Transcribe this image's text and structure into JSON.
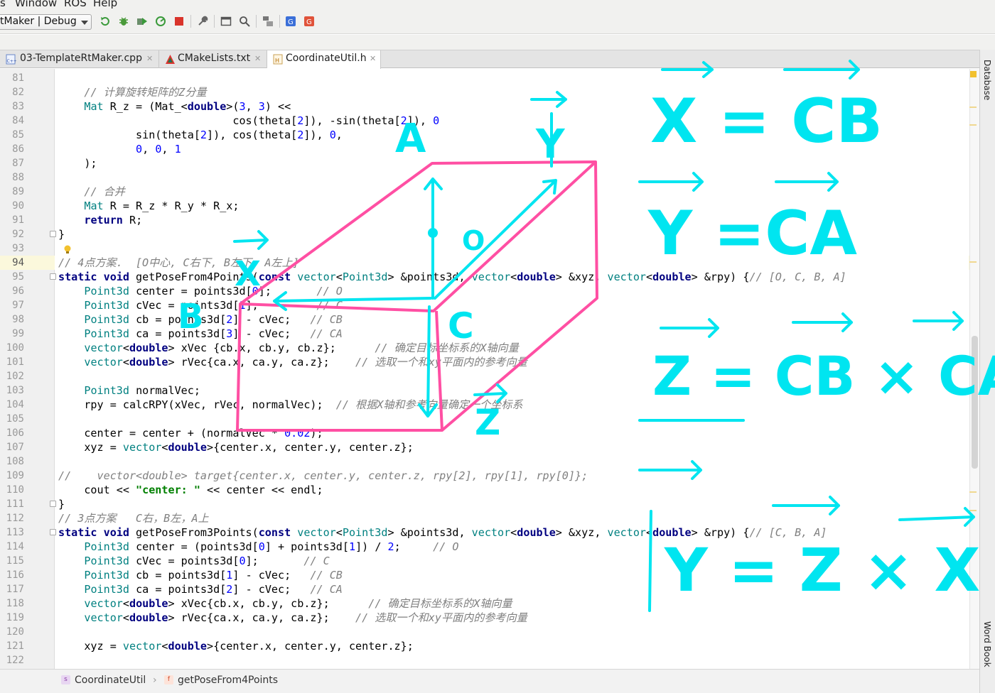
{
  "menu": {
    "item_s": "s",
    "item_window": "Window",
    "item_ros": "ROS",
    "item_help": "Help"
  },
  "toolbar": {
    "run_config": "tMaker | Debug"
  },
  "tabs": [
    {
      "label": "03-TemplateRtMaker.cpp",
      "icon": "cpp-file-icon"
    },
    {
      "label": "CMakeLists.txt",
      "icon": "cmake-icon"
    },
    {
      "label": "CoordinateUtil.h",
      "icon": "header-file-icon"
    }
  ],
  "sidebar": {
    "database": "Database",
    "wordbook": "Word Book"
  },
  "editor": {
    "current_line": "94",
    "lines": [
      {
        "n": "81"
      },
      {
        "n": "82"
      },
      {
        "n": "83"
      },
      {
        "n": "84"
      },
      {
        "n": "85"
      },
      {
        "n": "86"
      },
      {
        "n": "87"
      },
      {
        "n": "88"
      },
      {
        "n": "89"
      },
      {
        "n": "90"
      },
      {
        "n": "91"
      },
      {
        "n": "92"
      },
      {
        "n": "93"
      },
      {
        "n": "94"
      },
      {
        "n": "95"
      },
      {
        "n": "96"
      },
      {
        "n": "97"
      },
      {
        "n": "98"
      },
      {
        "n": "99"
      },
      {
        "n": "100"
      },
      {
        "n": "101"
      },
      {
        "n": "102"
      },
      {
        "n": "103"
      },
      {
        "n": "104"
      },
      {
        "n": "105"
      },
      {
        "n": "106"
      },
      {
        "n": "107"
      },
      {
        "n": "108"
      },
      {
        "n": "109"
      },
      {
        "n": "110"
      },
      {
        "n": "111"
      },
      {
        "n": "112"
      },
      {
        "n": "113"
      },
      {
        "n": "114"
      },
      {
        "n": "115"
      },
      {
        "n": "116"
      },
      {
        "n": "117"
      },
      {
        "n": "118"
      },
      {
        "n": "119"
      },
      {
        "n": "120"
      },
      {
        "n": "121"
      },
      {
        "n": "122"
      }
    ],
    "code": [
      [],
      [
        {
          "t": "    "
        },
        {
          "t": "// 计算旋转矩阵的Z分量",
          "c": "cm"
        }
      ],
      [
        {
          "t": "    "
        },
        {
          "t": "Mat",
          "c": "ty"
        },
        {
          "t": " R_z = (Mat_<"
        },
        {
          "t": "double",
          "c": "kw"
        },
        {
          "t": ">("
        },
        {
          "t": "3",
          "c": "nm"
        },
        {
          "t": ", "
        },
        {
          "t": "3",
          "c": "nm"
        },
        {
          "t": ") <<"
        }
      ],
      [
        {
          "t": "                           cos(theta["
        },
        {
          "t": "2",
          "c": "nm"
        },
        {
          "t": "]), -sin(theta["
        },
        {
          "t": "2",
          "c": "nm"
        },
        {
          "t": "]), "
        },
        {
          "t": "0",
          "c": "nm"
        }
      ],
      [
        {
          "t": "            sin(theta["
        },
        {
          "t": "2",
          "c": "nm"
        },
        {
          "t": "]), cos(theta["
        },
        {
          "t": "2",
          "c": "nm"
        },
        {
          "t": "]), "
        },
        {
          "t": "0",
          "c": "nm"
        },
        {
          "t": ","
        }
      ],
      [
        {
          "t": "            "
        },
        {
          "t": "0",
          "c": "nm"
        },
        {
          "t": ", "
        },
        {
          "t": "0",
          "c": "nm"
        },
        {
          "t": ", "
        },
        {
          "t": "1",
          "c": "nm"
        }
      ],
      [
        {
          "t": "    );"
        }
      ],
      [],
      [
        {
          "t": "    "
        },
        {
          "t": "// 合并",
          "c": "cm"
        }
      ],
      [
        {
          "t": "    "
        },
        {
          "t": "Mat",
          "c": "ty"
        },
        {
          "t": " R = R_z * R_y * R_x;"
        }
      ],
      [
        {
          "t": "    "
        },
        {
          "t": "return",
          "c": "kw"
        },
        {
          "t": " R;"
        }
      ],
      [
        {
          "t": "}"
        }
      ],
      [],
      [
        {
          "t": "// 4点方案.  [O中心, C右下, B左下, A左上]",
          "c": "cm"
        }
      ],
      [
        {
          "t": "static void",
          "c": "kw"
        },
        {
          "t": " getPoseFrom4Points("
        },
        {
          "t": "const",
          "c": "kw"
        },
        {
          "t": " "
        },
        {
          "t": "vector",
          "c": "ty"
        },
        {
          "t": "<"
        },
        {
          "t": "Point3d",
          "c": "ty"
        },
        {
          "t": "> &points3d, "
        },
        {
          "t": "vector",
          "c": "ty"
        },
        {
          "t": "<"
        },
        {
          "t": "double",
          "c": "kw"
        },
        {
          "t": "> &xyz, "
        },
        {
          "t": "vector",
          "c": "ty"
        },
        {
          "t": "<"
        },
        {
          "t": "double",
          "c": "kw"
        },
        {
          "t": "> &rpy) {"
        },
        {
          "t": "// [O, C, B, A]",
          "c": "cm"
        }
      ],
      [
        {
          "t": "    "
        },
        {
          "t": "Point3d",
          "c": "ty"
        },
        {
          "t": " center = points3d["
        },
        {
          "t": "0",
          "c": "nm"
        },
        {
          "t": "];       "
        },
        {
          "t": "// O",
          "c": "cm"
        }
      ],
      [
        {
          "t": "    "
        },
        {
          "t": "Point3d",
          "c": "ty"
        },
        {
          "t": " cVec = points3d["
        },
        {
          "t": "1",
          "c": "nm"
        },
        {
          "t": "];         "
        },
        {
          "t": "// C",
          "c": "cm"
        }
      ],
      [
        {
          "t": "    "
        },
        {
          "t": "Point3d",
          "c": "ty"
        },
        {
          "t": " cb = points3d["
        },
        {
          "t": "2",
          "c": "nm"
        },
        {
          "t": "] - cVec;   "
        },
        {
          "t": "// CB",
          "c": "cm"
        }
      ],
      [
        {
          "t": "    "
        },
        {
          "t": "Point3d",
          "c": "ty"
        },
        {
          "t": " ca = points3d["
        },
        {
          "t": "3",
          "c": "nm"
        },
        {
          "t": "] - cVec;   "
        },
        {
          "t": "// CA",
          "c": "cm"
        }
      ],
      [
        {
          "t": "    "
        },
        {
          "t": "vector",
          "c": "ty"
        },
        {
          "t": "<"
        },
        {
          "t": "double",
          "c": "kw"
        },
        {
          "t": "> xVec {cb.x, cb.y, cb.z};      "
        },
        {
          "t": "// 确定目标坐标系的X轴向量",
          "c": "cm"
        }
      ],
      [
        {
          "t": "    "
        },
        {
          "t": "vector",
          "c": "ty"
        },
        {
          "t": "<"
        },
        {
          "t": "double",
          "c": "kw"
        },
        {
          "t": "> rVec{ca.x, ca.y, ca.z};    "
        },
        {
          "t": "// 选取一个和xy平面内的参考向量",
          "c": "cm"
        }
      ],
      [],
      [
        {
          "t": "    "
        },
        {
          "t": "Point3d",
          "c": "ty"
        },
        {
          "t": " normalVec;"
        }
      ],
      [
        {
          "t": "    rpy = calcRPY(xVec, rVec, normalVec);  "
        },
        {
          "t": "// 根据X轴和参考向量确定一个坐标系",
          "c": "cm"
        }
      ],
      [],
      [
        {
          "t": "    center = center + (normalVec * "
        },
        {
          "t": "0.02",
          "c": "nm"
        },
        {
          "t": ");"
        }
      ],
      [
        {
          "t": "    xyz = "
        },
        {
          "t": "vector",
          "c": "ty"
        },
        {
          "t": "<"
        },
        {
          "t": "double",
          "c": "kw"
        },
        {
          "t": ">{center.x, center.y, center.z};"
        }
      ],
      [],
      [
        {
          "t": "//    vector<double> target{center.x, center.y, center.z, rpy[2], rpy[1], rpy[0]};",
          "c": "cm"
        }
      ],
      [
        {
          "t": "    cout << "
        },
        {
          "t": "\"center: \"",
          "c": "st"
        },
        {
          "t": " << center << endl;"
        }
      ],
      [
        {
          "t": "}"
        }
      ],
      [
        {
          "t": "// 3点方案   C右，B左，A上",
          "c": "cm"
        }
      ],
      [
        {
          "t": "static void",
          "c": "kw"
        },
        {
          "t": " getPoseFrom3Points("
        },
        {
          "t": "const",
          "c": "kw"
        },
        {
          "t": " "
        },
        {
          "t": "vector",
          "c": "ty"
        },
        {
          "t": "<"
        },
        {
          "t": "Point3d",
          "c": "ty"
        },
        {
          "t": "> &points3d, "
        },
        {
          "t": "vector",
          "c": "ty"
        },
        {
          "t": "<"
        },
        {
          "t": "double",
          "c": "kw"
        },
        {
          "t": "> &xyz, "
        },
        {
          "t": "vector",
          "c": "ty"
        },
        {
          "t": "<"
        },
        {
          "t": "double",
          "c": "kw"
        },
        {
          "t": "> &rpy) {"
        },
        {
          "t": "// [C, B, A]",
          "c": "cm"
        }
      ],
      [
        {
          "t": "    "
        },
        {
          "t": "Point3d",
          "c": "ty"
        },
        {
          "t": " center = (points3d["
        },
        {
          "t": "0",
          "c": "nm"
        },
        {
          "t": "] + points3d["
        },
        {
          "t": "1",
          "c": "nm"
        },
        {
          "t": "]) / "
        },
        {
          "t": "2",
          "c": "nm"
        },
        {
          "t": ";     "
        },
        {
          "t": "// O",
          "c": "cm"
        }
      ],
      [
        {
          "t": "    "
        },
        {
          "t": "Point3d",
          "c": "ty"
        },
        {
          "t": " cVec = points3d["
        },
        {
          "t": "0",
          "c": "nm"
        },
        {
          "t": "];       "
        },
        {
          "t": "// C",
          "c": "cm"
        }
      ],
      [
        {
          "t": "    "
        },
        {
          "t": "Point3d",
          "c": "ty"
        },
        {
          "t": " cb = points3d["
        },
        {
          "t": "1",
          "c": "nm"
        },
        {
          "t": "] - cVec;   "
        },
        {
          "t": "// CB",
          "c": "cm"
        }
      ],
      [
        {
          "t": "    "
        },
        {
          "t": "Point3d",
          "c": "ty"
        },
        {
          "t": " ca = points3d["
        },
        {
          "t": "2",
          "c": "nm"
        },
        {
          "t": "] - cVec;   "
        },
        {
          "t": "// CA",
          "c": "cm"
        }
      ],
      [
        {
          "t": "    "
        },
        {
          "t": "vector",
          "c": "ty"
        },
        {
          "t": "<"
        },
        {
          "t": "double",
          "c": "kw"
        },
        {
          "t": "> xVec{cb.x, cb.y, cb.z};      "
        },
        {
          "t": "// 确定目标坐标系的X轴向量",
          "c": "cm"
        }
      ],
      [
        {
          "t": "    "
        },
        {
          "t": "vector",
          "c": "ty"
        },
        {
          "t": "<"
        },
        {
          "t": "double",
          "c": "kw"
        },
        {
          "t": "> rVec{ca.x, ca.y, ca.z};    "
        },
        {
          "t": "// 选取一个和xy平面内的参考向量",
          "c": "cm"
        }
      ],
      [],
      [
        {
          "t": "    xyz = "
        },
        {
          "t": "vector",
          "c": "ty"
        },
        {
          "t": "<"
        },
        {
          "t": "double",
          "c": "kw"
        },
        {
          "t": ">{center.x, center.y, center.z};"
        }
      ],
      []
    ]
  },
  "breadcrumb": {
    "class": "CoordinateUtil",
    "class_icon": "s",
    "function": "getPoseFrom4Points",
    "function_icon": "f"
  },
  "annotations": {
    "eq1": "X = CB",
    "eq2": "Y =CA",
    "eq3": "Z = CB × CA",
    "eq4": "Y = Z × X",
    "label_A": "A",
    "label_Y": "Y",
    "label_O": "O",
    "label_X": "X",
    "label_B": "B",
    "label_C": "C",
    "label_Z": "Z",
    "colors": {
      "cyan": "#00e5f0",
      "pink": "#ff4fa3"
    }
  }
}
